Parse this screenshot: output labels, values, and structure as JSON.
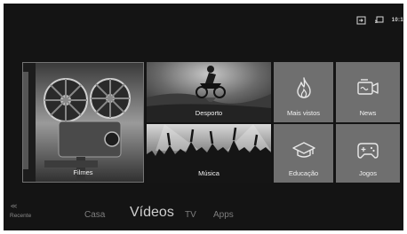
{
  "status": {
    "time": "10:1",
    "icons": [
      "input-source-icon",
      "screen-cast-icon"
    ]
  },
  "tiles": {
    "filmes": {
      "label": "Filmes",
      "icon": "film-projector-image"
    },
    "desporto": {
      "label": "Desporto",
      "icon": "motocross-image"
    },
    "musica": {
      "label": "Música",
      "icon": "concert-crowd-image"
    },
    "mais_vistos": {
      "label": "Mais vistos",
      "icon": "flame-icon"
    },
    "news": {
      "label": "News",
      "icon": "news-camera-icon"
    },
    "educacao": {
      "label": "Educação",
      "icon": "graduation-cap-icon"
    },
    "jogos": {
      "label": "Jogos",
      "icon": "gamepad-icon"
    }
  },
  "nav": {
    "recent_arrow": "<<",
    "recent_label": "Recente",
    "tabs": [
      {
        "label": "Casa",
        "active": false
      },
      {
        "label": "Vídeos",
        "active": true
      },
      {
        "label": "TV",
        "active": false
      },
      {
        "label": "Apps",
        "active": false
      }
    ]
  },
  "colors": {
    "background": "#141414",
    "tile_gray": "#6f6f6f",
    "text_active": "#cfcfcf",
    "text_inactive": "#7e7e7e"
  }
}
